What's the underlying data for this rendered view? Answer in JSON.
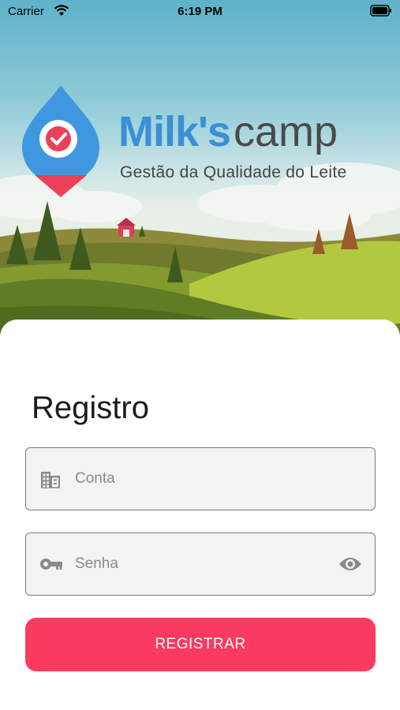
{
  "status_bar": {
    "carrier": "Carrier",
    "time": "6:19 PM",
    "icons": [
      "wifi-icon",
      "battery-icon"
    ]
  },
  "header": {
    "brand_bold": "Milk's",
    "brand_light": "camp",
    "tagline": "Gestão da Qualidade do Leite"
  },
  "form": {
    "title": "Registro",
    "account": {
      "value": "",
      "placeholder": "Conta",
      "icon": "building-icon"
    },
    "password": {
      "value": "",
      "placeholder": "Senha",
      "icon": "key-icon",
      "toggle_icon": "eye-icon"
    },
    "submit_label": "REGISTRAR"
  },
  "colors": {
    "accent": "#fa3b5f",
    "brand_blue": "#3a8fd6",
    "field_background": "#f3f3f3"
  }
}
